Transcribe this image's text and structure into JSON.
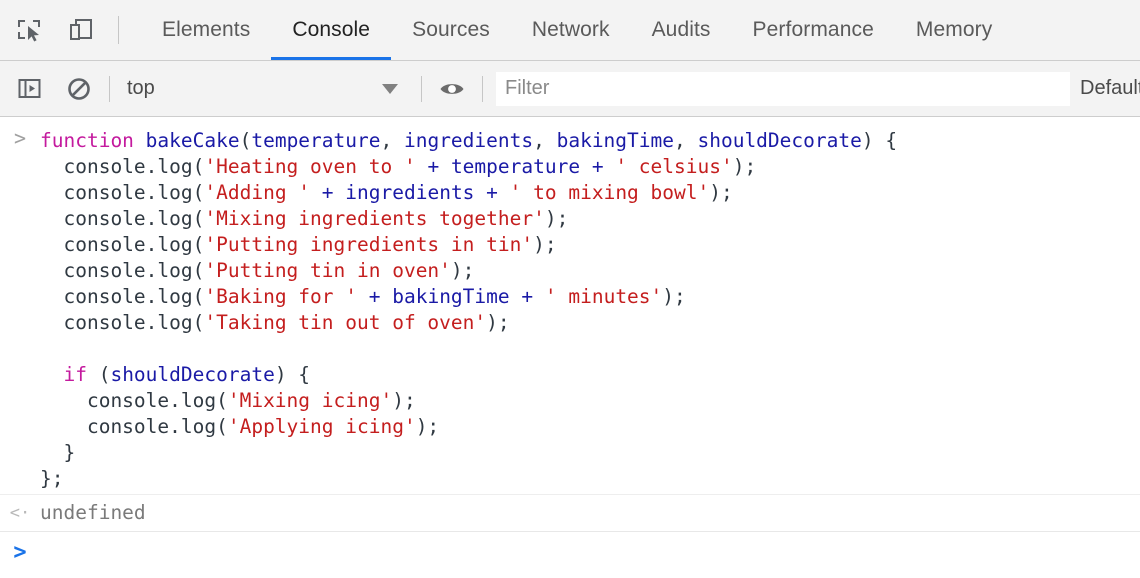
{
  "tabbar": {
    "icons": [
      {
        "name": "inspect-element-icon",
        "title": "Inspect element"
      },
      {
        "name": "device-toolbar-icon",
        "title": "Toggle device toolbar"
      }
    ],
    "tabs": [
      {
        "label": "Elements",
        "active": false
      },
      {
        "label": "Console",
        "active": true
      },
      {
        "label": "Sources",
        "active": false
      },
      {
        "label": "Network",
        "active": false
      },
      {
        "label": "Audits",
        "active": false
      },
      {
        "label": "Performance",
        "active": false
      },
      {
        "label": "Memory",
        "active": false
      }
    ],
    "active_tab": "Console",
    "active_underline_color": "#1a73e8"
  },
  "filterbar": {
    "sidebar_toggle_icon": "console-sidebar-icon",
    "clear_console_icon": "clear-console-icon",
    "context_value": "top",
    "context_caret_icon": "chevron-down-icon",
    "eye_icon": "live-expression-eye-icon",
    "filter_value": "",
    "filter_placeholder": "Filter",
    "log_levels_label": "Default"
  },
  "console": {
    "input_prompt_glyph": ">",
    "output_prompt_glyph": "<·",
    "prompt_glyph": ">",
    "input_lines": [
      [
        {
          "t": "function ",
          "c": "kw"
        },
        {
          "t": "bakeCake",
          "c": "id"
        },
        {
          "t": "(",
          "c": "pln"
        },
        {
          "t": "temperature",
          "c": "id"
        },
        {
          "t": ", ",
          "c": "pln"
        },
        {
          "t": "ingredients",
          "c": "id"
        },
        {
          "t": ", ",
          "c": "pln"
        },
        {
          "t": "bakingTime",
          "c": "id"
        },
        {
          "t": ", ",
          "c": "pln"
        },
        {
          "t": "shouldDecorate",
          "c": "id"
        },
        {
          "t": ") {",
          "c": "pln"
        }
      ],
      [
        {
          "t": "  console.log(",
          "c": "pln"
        },
        {
          "t": "'Heating oven to '",
          "c": "str"
        },
        {
          "t": " + ",
          "c": "id"
        },
        {
          "t": "temperature",
          "c": "id"
        },
        {
          "t": " + ",
          "c": "id"
        },
        {
          "t": "' celsius'",
          "c": "str"
        },
        {
          "t": ");",
          "c": "pln"
        }
      ],
      [
        {
          "t": "  console.log(",
          "c": "pln"
        },
        {
          "t": "'Adding '",
          "c": "str"
        },
        {
          "t": " + ",
          "c": "id"
        },
        {
          "t": "ingredients",
          "c": "id"
        },
        {
          "t": " + ",
          "c": "id"
        },
        {
          "t": "' to mixing bowl'",
          "c": "str"
        },
        {
          "t": ");",
          "c": "pln"
        }
      ],
      [
        {
          "t": "  console.log(",
          "c": "pln"
        },
        {
          "t": "'Mixing ingredients together'",
          "c": "str"
        },
        {
          "t": ");",
          "c": "pln"
        }
      ],
      [
        {
          "t": "  console.log(",
          "c": "pln"
        },
        {
          "t": "'Putting ingredients in tin'",
          "c": "str"
        },
        {
          "t": ");",
          "c": "pln"
        }
      ],
      [
        {
          "t": "  console.log(",
          "c": "pln"
        },
        {
          "t": "'Putting tin in oven'",
          "c": "str"
        },
        {
          "t": ");",
          "c": "pln"
        }
      ],
      [
        {
          "t": "  console.log(",
          "c": "pln"
        },
        {
          "t": "'Baking for '",
          "c": "str"
        },
        {
          "t": " + ",
          "c": "id"
        },
        {
          "t": "bakingTime",
          "c": "id"
        },
        {
          "t": " + ",
          "c": "id"
        },
        {
          "t": "' minutes'",
          "c": "str"
        },
        {
          "t": ");",
          "c": "pln"
        }
      ],
      [
        {
          "t": "  console.log(",
          "c": "pln"
        },
        {
          "t": "'Taking tin out of oven'",
          "c": "str"
        },
        {
          "t": ");",
          "c": "pln"
        }
      ],
      [
        {
          "t": "",
          "c": "pln"
        }
      ],
      [
        {
          "t": "  ",
          "c": "pln"
        },
        {
          "t": "if",
          "c": "kw"
        },
        {
          "t": " (",
          "c": "pln"
        },
        {
          "t": "shouldDecorate",
          "c": "id"
        },
        {
          "t": ") {",
          "c": "pln"
        }
      ],
      [
        {
          "t": "    console.log(",
          "c": "pln"
        },
        {
          "t": "'Mixing icing'",
          "c": "str"
        },
        {
          "t": ");",
          "c": "pln"
        }
      ],
      [
        {
          "t": "    console.log(",
          "c": "pln"
        },
        {
          "t": "'Applying icing'",
          "c": "str"
        },
        {
          "t": ");",
          "c": "pln"
        }
      ],
      [
        {
          "t": "  }",
          "c": "pln"
        }
      ],
      [
        {
          "t": "};",
          "c": "pln"
        }
      ]
    ],
    "result_value": "undefined"
  },
  "colors": {
    "keyword": "#c41a9e",
    "identifier": "#1a1aa6",
    "string": "#c41e1e",
    "plain": "#303942",
    "accent": "#1a73e8",
    "toolbar_bg": "#f3f3f3",
    "result_text": "#7a7a7a"
  }
}
